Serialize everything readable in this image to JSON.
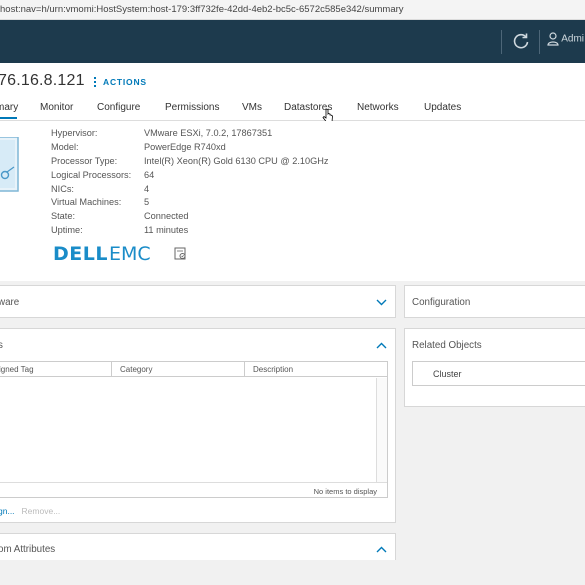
{
  "browser": {
    "url": "host:nav=h/urn:vmomi:HostSystem:host-179:3ff732fe-42dd-4eb2-bc5c-6572c585e342/summary"
  },
  "topbar": {
    "user_label": "Admi",
    "refresh_icon": "refresh-icon",
    "user_icon": "user-icon",
    "background": "#1d3a4d"
  },
  "host": {
    "title": "76.16.8.121",
    "actions_label": "ACTIONS"
  },
  "tabs": [
    {
      "label": "mary",
      "active": true
    },
    {
      "label": "Monitor",
      "active": false
    },
    {
      "label": "Configure",
      "active": false
    },
    {
      "label": "Permissions",
      "active": false
    },
    {
      "label": "VMs",
      "active": false
    },
    {
      "label": "Datastores",
      "active": false
    },
    {
      "label": "Networks",
      "active": false
    },
    {
      "label": "Updates",
      "active": false
    }
  ],
  "properties": [
    {
      "key": "Hypervisor:",
      "value": "VMware ESXi, 7.0.2, 17867351"
    },
    {
      "key": "Model:",
      "value": "PowerEdge R740xd"
    },
    {
      "key": "Processor Type:",
      "value": "Intel(R) Xeon(R) Gold 6130 CPU @ 2.10GHz"
    },
    {
      "key": "Logical Processors:",
      "value": "64"
    },
    {
      "key": "NICs:",
      "value": "4"
    },
    {
      "key": "Virtual Machines:",
      "value": "5"
    },
    {
      "key": "State:",
      "value": "Connected"
    },
    {
      "key": "Uptime:",
      "value": "11 minutes"
    }
  ],
  "logo": {
    "dell": "DELL",
    "emc": "EMC",
    "color": "#1a8cc8"
  },
  "cards": {
    "hardware_title": "ware",
    "configuration_title": "Configuration",
    "tags_title": "s",
    "related_title": "Related Objects",
    "custom_attributes_title": "om Attributes"
  },
  "tag_table": {
    "columns": [
      "igned Tag",
      "Category",
      "Description"
    ],
    "empty_text": "No items to display"
  },
  "tag_actions": {
    "assign": "gn...",
    "remove": "Remove..."
  },
  "related": {
    "cluster_label": "Cluster"
  },
  "accent": "#0079b8"
}
